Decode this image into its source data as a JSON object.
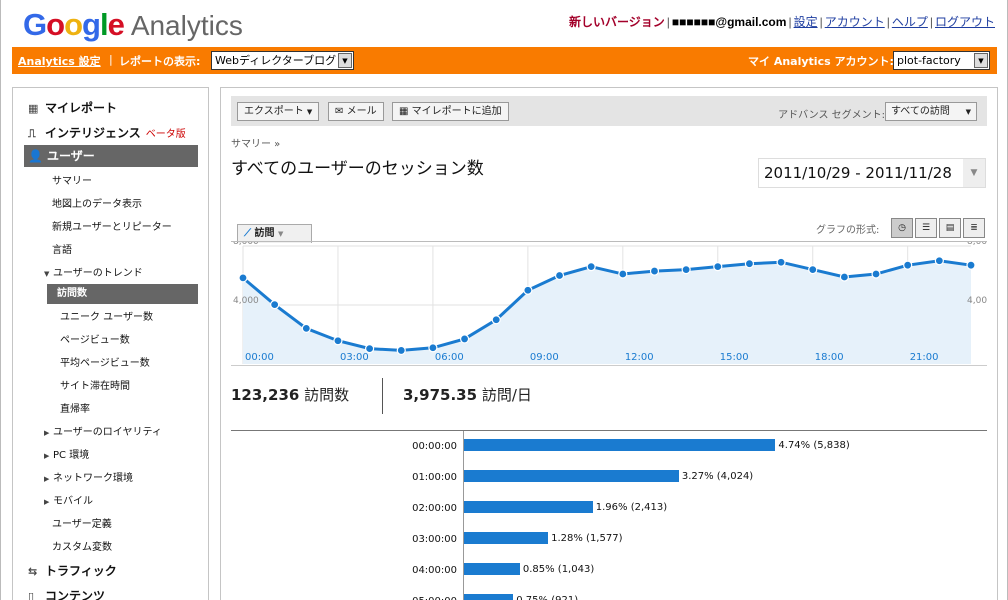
{
  "header": {
    "logo_google": "Google",
    "logo_analytics": "Analytics",
    "links": {
      "new_version": "新しいバージョン",
      "email": "■■■■■■@gmail.com",
      "settings": "設定",
      "account": "アカウント",
      "help": "ヘルプ",
      "logout": "ログアウト"
    }
  },
  "orange_bar": {
    "analytics_settings": "Analytics 設定",
    "report_display_label": "レポートの表示:",
    "report_select": "Webディレクターブログ",
    "my_account_label": "マイ Analytics アカウント:",
    "account_select": "plot-factory"
  },
  "sidebar": {
    "my_report": "マイレポート",
    "intelligence": "インテリジェンス",
    "beta": "ベータ版",
    "users": "ユーザー",
    "items": [
      {
        "label": "サマリー"
      },
      {
        "label": "地図上のデータ表示"
      },
      {
        "label": "新規ユーザーとリピーター"
      },
      {
        "label": "言語"
      },
      {
        "label": "ユーザーのトレンド"
      },
      {
        "label": "訪問数"
      },
      {
        "label": "ユニーク ユーザー数"
      },
      {
        "label": "ページビュー数"
      },
      {
        "label": "平均ページビュー数"
      },
      {
        "label": "サイト滞在時間"
      },
      {
        "label": "直帰率"
      },
      {
        "label": "ユーザーのロイヤリティ"
      },
      {
        "label": "PC 環境"
      },
      {
        "label": "ネットワーク環境"
      },
      {
        "label": "モバイル"
      },
      {
        "label": "ユーザー定義"
      },
      {
        "label": "カスタム変数"
      }
    ],
    "traffic": "トラフィック",
    "content": "コンテンツ"
  },
  "toolbar": {
    "export": "エクスポート",
    "mail": "メール",
    "add_my_report": "マイレポートに追加",
    "segment_label": "アドバンス セグメント:",
    "segment_select": "すべての訪問"
  },
  "report": {
    "breadcrumb": "サマリー »",
    "title": "すべてのユーザーのセッション数",
    "date_range": "2011/10/29 - 2011/11/28",
    "tab_label": "訪問",
    "graph_format_label": "グラフの形式:",
    "stat_visits_num": "123,236",
    "stat_visits_unit": "訪問数",
    "stat_perday_num": "3,975.35",
    "stat_perday_unit": "訪問/日"
  },
  "chart_data": {
    "type": "area",
    "x": [
      "00:00",
      "01:00",
      "02:00",
      "03:00",
      "04:00",
      "05:00",
      "06:00",
      "07:00",
      "08:00",
      "09:00",
      "10:00",
      "11:00",
      "12:00",
      "13:00",
      "14:00",
      "15:00",
      "16:00",
      "17:00",
      "18:00",
      "19:00",
      "20:00",
      "21:00",
      "22:00",
      "23:00"
    ],
    "x_tick_labels": [
      "00:00",
      "03:00",
      "06:00",
      "09:00",
      "12:00",
      "15:00",
      "18:00",
      "21:00"
    ],
    "values": [
      5838,
      4024,
      2413,
      1577,
      1043,
      921,
      1100,
      1700,
      3000,
      5000,
      6000,
      6600,
      6100,
      6300,
      6400,
      6600,
      6800,
      6900,
      6400,
      5900,
      6100,
      6700,
      7000,
      6700
    ],
    "y_tick_labels": [
      "8,000",
      "4,000"
    ],
    "ylim": [
      0,
      8000
    ],
    "grid": true,
    "color": "#1a7bd0",
    "fill": "#e6f1fa"
  },
  "table": {
    "rows": [
      {
        "label": "00:00:00",
        "pct": 4.74,
        "text": "4.74% (5,838)"
      },
      {
        "label": "01:00:00",
        "pct": 3.27,
        "text": "3.27% (4,024)"
      },
      {
        "label": "02:00:00",
        "pct": 1.96,
        "text": "1.96% (2,413)"
      },
      {
        "label": "03:00:00",
        "pct": 1.28,
        "text": "1.28% (1,577)"
      },
      {
        "label": "04:00:00",
        "pct": 0.85,
        "text": "0.85% (1,043)"
      },
      {
        "label": "05:00:00",
        "pct": 0.75,
        "text": "0.75% (921)"
      }
    ]
  }
}
